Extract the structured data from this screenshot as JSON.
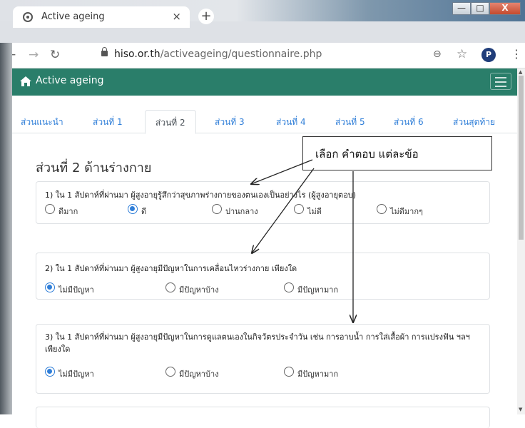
{
  "browser": {
    "tab_title": "Active ageing",
    "tab_close": "×",
    "new_tab": "+",
    "url_host": "hiso.or.th",
    "url_path": "/activeageing/questionnaire.php",
    "avatar_letter": "P",
    "window_min": "—",
    "window_max": "□",
    "window_close": "X"
  },
  "site": {
    "brand": "Active ageing",
    "accent": "#2a7e6a"
  },
  "tabs": [
    {
      "label": "ส่วนแนะนำ"
    },
    {
      "label": "ส่วนที่ 1"
    },
    {
      "label": "ส่วนที่ 2",
      "active": true
    },
    {
      "label": "ส่วนที่ 3"
    },
    {
      "label": "ส่วนที่ 4"
    },
    {
      "label": "ส่วนที่ 5"
    },
    {
      "label": "ส่วนที่ 6"
    },
    {
      "label": "ส่วนสุดท้าย"
    }
  ],
  "section_title": "ส่วนที่ 2 ด้านร่างกาย",
  "callout": "เลือก คำตอบ แต่ละข้อ",
  "questions": [
    {
      "text": "1) ใน 1 สัปดาห์ที่ผ่านมา ผู้สูงอายุรู้สึกว่าสุขภาพร่างกายของตนเองเป็นอย่างไร (ผู้สูงอายุตอบ)",
      "options": [
        {
          "label": "ดีมาก",
          "checked": false
        },
        {
          "label": "ดี",
          "checked": true
        },
        {
          "label": "ปานกลาง",
          "checked": false
        },
        {
          "label": "ไม่ดี",
          "checked": false
        },
        {
          "label": "ไม่ดีมากๆ",
          "checked": false
        }
      ]
    },
    {
      "text": "2) ใน 1 สัปดาห์ที่ผ่านมา ผู้สูงอายุมีปัญหาในการเคลื่อนไหวร่างกาย เพียงใด",
      "options": [
        {
          "label": "ไม่มีปัญหา",
          "checked": true
        },
        {
          "label": "มีปัญหาบ้าง",
          "checked": false
        },
        {
          "label": "มีปัญหามาก",
          "checked": false
        }
      ]
    },
    {
      "text": "3) ใน 1 สัปดาห์ที่ผ่านมา ผู้สูงอายุมีปัญหาในการดูแลตนเองในกิจวัตรประจำวัน เช่น การอาบน้ำ การใส่เสื้อผ้า การแปรงฟัน ฯลฯ เพียงใด",
      "options": [
        {
          "label": "ไม่มีปัญหา",
          "checked": true
        },
        {
          "label": "มีปัญหาบ้าง",
          "checked": false
        },
        {
          "label": "มีปัญหามาก",
          "checked": false
        }
      ]
    }
  ]
}
